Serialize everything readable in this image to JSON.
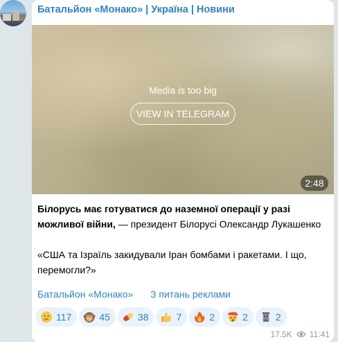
{
  "channel": {
    "title": "Батальйон «Монако» | Україна | Новини"
  },
  "media": {
    "notice": "Media is too big",
    "button_label": "VIEW IN TELEGRAM",
    "duration": "2:48"
  },
  "post": {
    "headline": "Білорусь має готуватися до наземної операції у разі можливої війни,",
    "attribution": " — президент Білорусі Олександр Лукашенко",
    "quote": "«США та Ізраїль закидували Іран бомбами і ракетами. І що, перемогли?»"
  },
  "links": [
    "Батальйон «Монако»",
    "З питань реклами"
  ],
  "reactions": [
    {
      "icon": "thinking-face-emoji-icon",
      "count": "117"
    },
    {
      "icon": "see-no-evil-monkey-emoji-icon",
      "count": "45"
    },
    {
      "icon": "pill-emoji-icon",
      "count": "38"
    },
    {
      "icon": "thumbs-up-emoji-icon",
      "count": "7"
    },
    {
      "icon": "fire-emoji-icon",
      "count": "2"
    },
    {
      "icon": "exploding-head-emoji-icon",
      "count": "2"
    },
    {
      "icon": "moai-emoji-icon",
      "count": "2"
    }
  ],
  "meta": {
    "views": "17.5K",
    "time": "11:41"
  },
  "colors": {
    "accent": "#2f81c6",
    "reaction_bg": "#e8f2fb",
    "page_bg": "#dfe6e9"
  }
}
